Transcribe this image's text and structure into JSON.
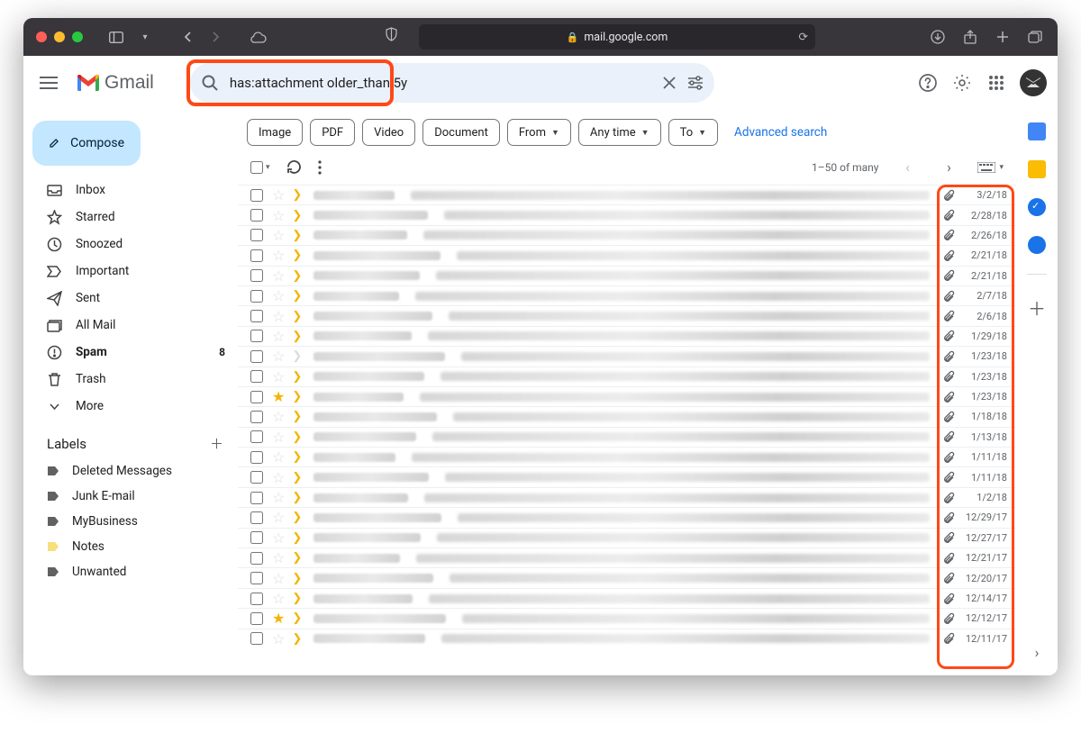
{
  "browser": {
    "url": "mail.google.com"
  },
  "header": {
    "app_name": "Gmail",
    "search_value": "has:attachment older_than:5y"
  },
  "compose_label": "Compose",
  "nav": [
    {
      "icon": "inbox",
      "label": "Inbox"
    },
    {
      "icon": "star",
      "label": "Starred"
    },
    {
      "icon": "clock",
      "label": "Snoozed"
    },
    {
      "icon": "important",
      "label": "Important"
    },
    {
      "icon": "send",
      "label": "Sent"
    },
    {
      "icon": "allmail",
      "label": "All Mail"
    },
    {
      "icon": "spam",
      "label": "Spam",
      "badge": "8",
      "active": true
    },
    {
      "icon": "trash",
      "label": "Trash"
    },
    {
      "icon": "more",
      "label": "More"
    }
  ],
  "labels_header": "Labels",
  "labels": [
    {
      "label": "Deleted Messages",
      "color": "#616161"
    },
    {
      "label": "Junk E-mail",
      "color": "#616161"
    },
    {
      "label": "MyBusiness",
      "color": "#616161"
    },
    {
      "label": "Notes",
      "color": "#f7e07b"
    },
    {
      "label": "Unwanted",
      "color": "#616161"
    }
  ],
  "chips": [
    {
      "label": "Image"
    },
    {
      "label": "PDF"
    },
    {
      "label": "Video"
    },
    {
      "label": "Document"
    },
    {
      "label": "From",
      "dropdown": true
    },
    {
      "label": "Any time",
      "dropdown": true
    },
    {
      "label": "To",
      "dropdown": true
    }
  ],
  "advanced_search_label": "Advanced search",
  "pagination": "1–50 of many",
  "emails": [
    {
      "date": "3/2/18",
      "starred": false,
      "important": true
    },
    {
      "date": "2/28/18",
      "starred": false,
      "important": true
    },
    {
      "date": "2/26/18",
      "starred": false,
      "important": true
    },
    {
      "date": "2/21/18",
      "starred": false,
      "important": true
    },
    {
      "date": "2/21/18",
      "starred": false,
      "important": true
    },
    {
      "date": "2/7/18",
      "starred": false,
      "important": true
    },
    {
      "date": "2/6/18",
      "starred": false,
      "important": true
    },
    {
      "date": "1/29/18",
      "starred": false,
      "important": true
    },
    {
      "date": "1/23/18",
      "starred": false,
      "important": false
    },
    {
      "date": "1/23/18",
      "starred": false,
      "important": true
    },
    {
      "date": "1/23/18",
      "starred": true,
      "important": true
    },
    {
      "date": "1/18/18",
      "starred": false,
      "important": true
    },
    {
      "date": "1/13/18",
      "starred": false,
      "important": true
    },
    {
      "date": "1/11/18",
      "starred": false,
      "important": true
    },
    {
      "date": "1/11/18",
      "starred": false,
      "important": true
    },
    {
      "date": "1/2/18",
      "starred": false,
      "important": true
    },
    {
      "date": "12/29/17",
      "starred": false,
      "important": true
    },
    {
      "date": "12/27/17",
      "starred": false,
      "important": true
    },
    {
      "date": "12/21/17",
      "starred": false,
      "important": true
    },
    {
      "date": "12/20/17",
      "starred": false,
      "important": true
    },
    {
      "date": "12/14/17",
      "starred": false,
      "important": true
    },
    {
      "date": "12/12/17",
      "starred": true,
      "important": true
    },
    {
      "date": "12/11/17",
      "starred": false,
      "important": true
    }
  ]
}
